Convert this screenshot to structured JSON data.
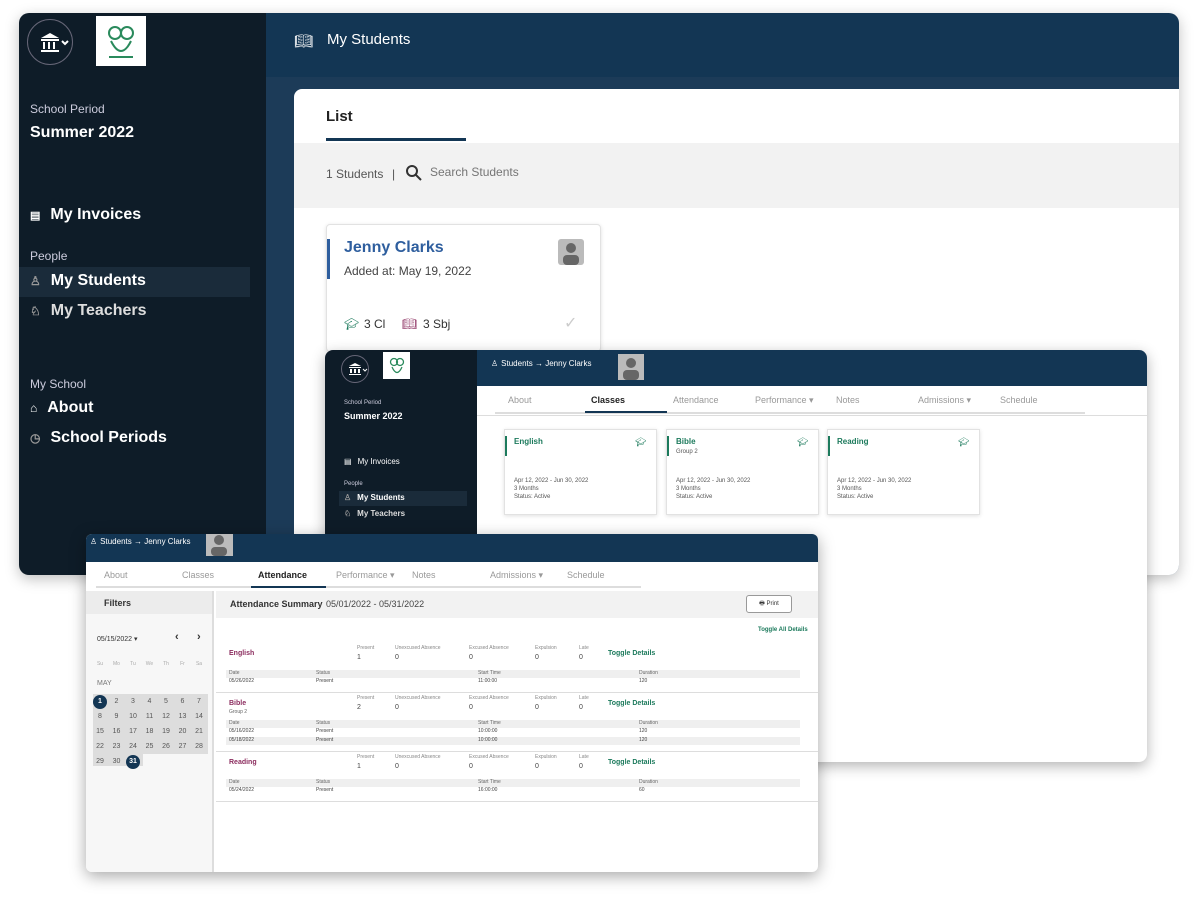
{
  "win1": {
    "school_period_label": "School Period",
    "school_period": "Summer 2022",
    "nav": {
      "invoices": "My Invoices",
      "people": "People",
      "students": "My Students",
      "teachers": "My Teachers",
      "my_school": "My School",
      "about": "About",
      "periods": "School Periods"
    },
    "title": "My Students",
    "tab": "List",
    "count": "1 Students",
    "divider": "|",
    "search_placeholder": "Search Students",
    "student": {
      "name": "Jenny Clarks",
      "added": "Added at: May 19, 2022",
      "classes": "3 Cl",
      "subjects": "3 Sbj"
    }
  },
  "win2": {
    "school_period_label": "School Period",
    "school_period": "Summer 2022",
    "nav": {
      "invoices": "My Invoices",
      "people": "People",
      "students": "My Students",
      "teachers": "My Teachers"
    },
    "crumb": {
      "students": "Students",
      "arrow": "→",
      "name": "Jenny Clarks"
    },
    "tabs": [
      "About",
      "Classes",
      "Attendance",
      "Performance ▾",
      "Notes",
      "Admissions ▾",
      "Schedule"
    ],
    "classes": [
      {
        "name": "English",
        "group": "",
        "dates": "Apr 12, 2022 - Jun 30, 2022",
        "duration": "3 Months",
        "status": "Status: Active"
      },
      {
        "name": "Bible",
        "group": "Group 2",
        "dates": "Apr 12, 2022 - Jun 30, 2022",
        "duration": "3 Months",
        "status": "Status: Active"
      },
      {
        "name": "Reading",
        "group": "",
        "dates": "Apr 12, 2022 - Jun 30, 2022",
        "duration": "3 Months",
        "status": "Status: Active"
      }
    ]
  },
  "win3": {
    "crumb": {
      "students": "Students",
      "arrow": "→",
      "name": "Jenny Clarks"
    },
    "tabs": [
      "About",
      "Classes",
      "Attendance",
      "Performance ▾",
      "Notes",
      "Admissions ▾",
      "Schedule"
    ],
    "filters": "Filters",
    "date": "05/15/2022 ▾",
    "prev": "‹",
    "next": "›",
    "weekdays": [
      "Su",
      "Mo",
      "Tu",
      "We",
      "Th",
      "Fr",
      "Sa"
    ],
    "month": "MAY",
    "days": [
      [
        "1",
        "2",
        "3",
        "4",
        "5",
        "6",
        "7"
      ],
      [
        "8",
        "9",
        "10",
        "11",
        "12",
        "13",
        "14"
      ],
      [
        "15",
        "16",
        "17",
        "18",
        "19",
        "20",
        "21"
      ],
      [
        "22",
        "23",
        "24",
        "25",
        "26",
        "27",
        "28"
      ],
      [
        "29",
        "30",
        "31"
      ]
    ],
    "summary_title": "Attendance Summary",
    "summary_range": "05/01/2022 - 05/31/2022",
    "print": "Print",
    "toggle_all": "Toggle All Details",
    "headers": {
      "present": "Present",
      "unexcused": "Unexcused Absence",
      "excused": "Excused Absence",
      "expulsion": "Expulsion",
      "late": "Late",
      "toggle": "Toggle Details",
      "date": "Date",
      "status": "Status",
      "start": "Start Time",
      "duration": "Duration"
    },
    "subjects": [
      {
        "name": "English",
        "group": "",
        "present": "1",
        "unexcused": "0",
        "excused": "0",
        "expulsion": "0",
        "late": "0",
        "rows": [
          [
            "05/26/2022",
            "Present",
            "11:00:00",
            "120"
          ]
        ]
      },
      {
        "name": "Bible",
        "group": "Group 2",
        "present": "2",
        "unexcused": "0",
        "excused": "0",
        "expulsion": "0",
        "late": "0",
        "rows": [
          [
            "05/16/2022",
            "Present",
            "10:00:00",
            "120"
          ],
          [
            "05/18/2022",
            "Present",
            "10:00:00",
            "120"
          ]
        ]
      },
      {
        "name": "Reading",
        "group": "",
        "present": "1",
        "unexcused": "0",
        "excused": "0",
        "expulsion": "0",
        "late": "0",
        "rows": [
          [
            "05/24/2022",
            "Present",
            "16:00:00",
            "60"
          ]
        ]
      }
    ]
  },
  "colors": {
    "navy": "#133654",
    "dark": "#0e1c28",
    "accent": "#1c7a5c",
    "link": "#2e5e9e",
    "subject": "#8b2c5e"
  }
}
